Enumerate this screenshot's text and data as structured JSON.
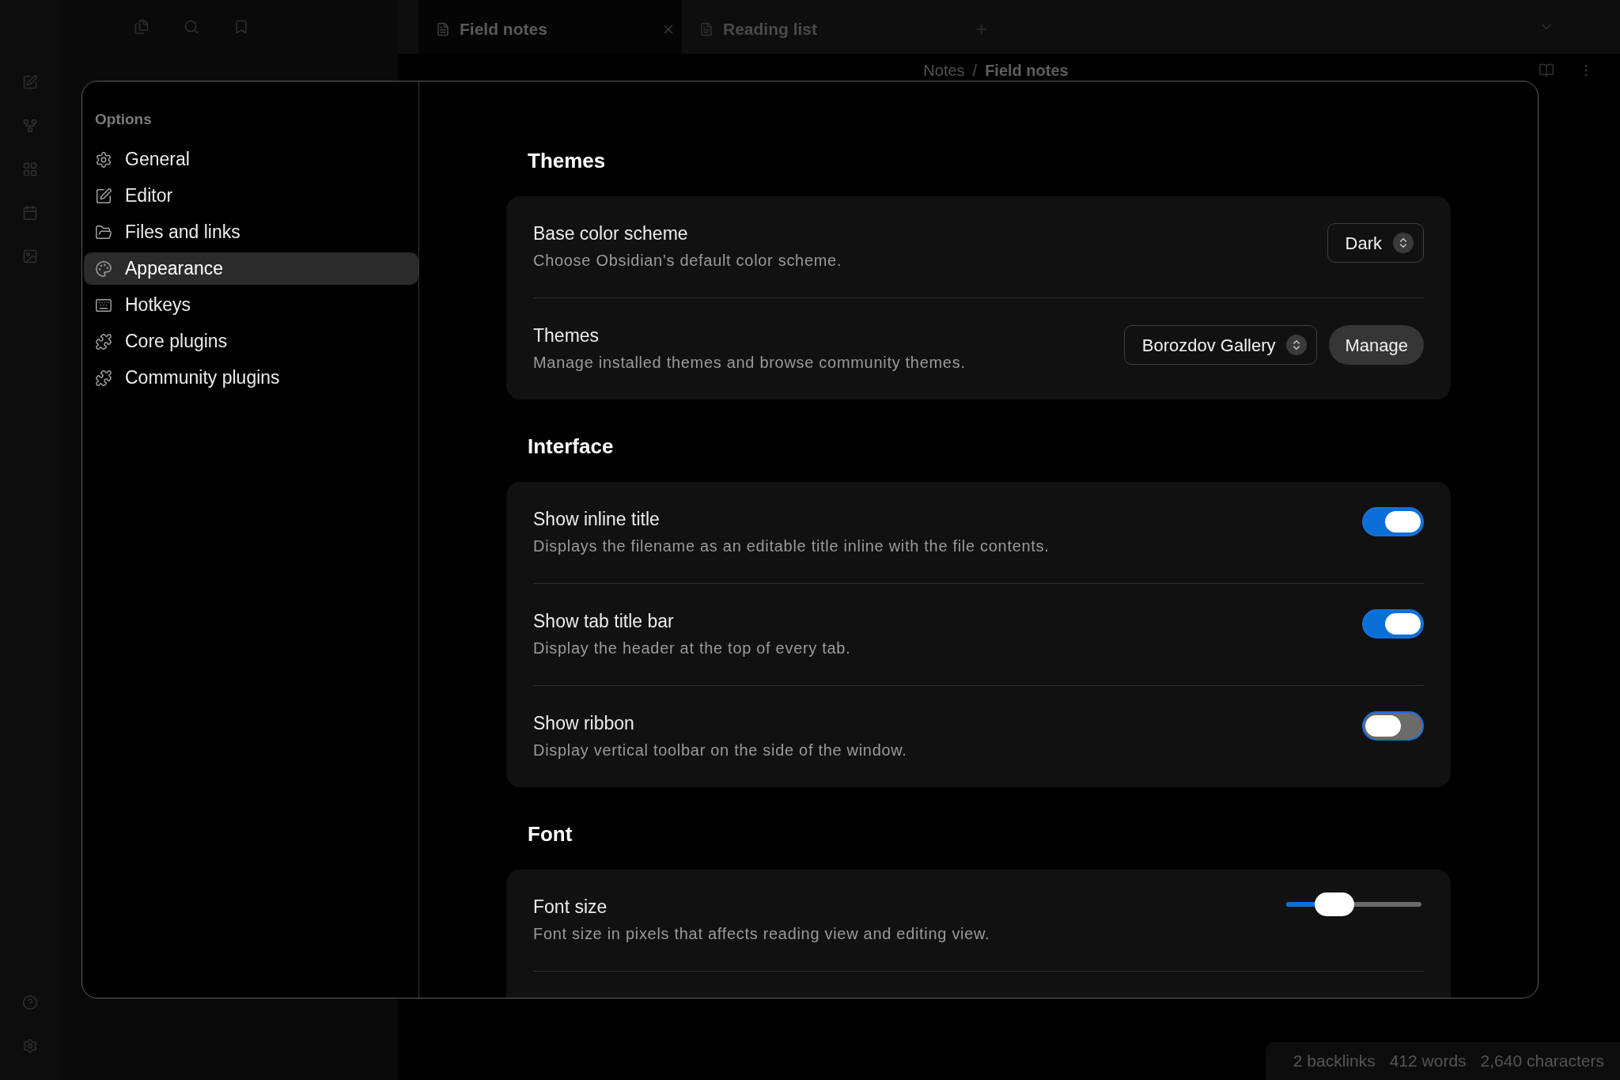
{
  "background": {
    "tabs": [
      {
        "title": "Field notes",
        "selected": true
      },
      {
        "title": "Reading list",
        "selected": false
      }
    ],
    "breadcrumb": {
      "items": [
        "Notes",
        "Field notes"
      ],
      "separator": "/"
    },
    "status_bar": [
      "2 backlinks",
      "412 words",
      "2,640 characters"
    ]
  },
  "settings": {
    "sidebar": {
      "heading": "Options",
      "items": [
        {
          "label": "General",
          "selected": false
        },
        {
          "label": "Editor",
          "selected": false
        },
        {
          "label": "Files and links",
          "selected": false
        },
        {
          "label": "Appearance",
          "selected": true
        },
        {
          "label": "Hotkeys",
          "selected": false
        },
        {
          "label": "Core plugins",
          "selected": false
        },
        {
          "label": "Community plugins",
          "selected": false
        }
      ]
    },
    "sections": [
      {
        "heading": "Themes",
        "settings": [
          {
            "kind": "dropdown",
            "name": "Base color scheme",
            "description": "Choose Obsidian's default color scheme.",
            "value": "Dark"
          },
          {
            "kind": "dropdown",
            "name": "Themes",
            "description": "Manage installed themes and browse community themes.",
            "value": "Borozdov Gallery",
            "button": "Manage"
          }
        ]
      },
      {
        "heading": "Interface",
        "settings": [
          {
            "kind": "toggle",
            "name": "Show inline title",
            "description": "Displays the filename as an editable title inline with the file contents.",
            "on": true
          },
          {
            "kind": "toggle",
            "name": "Show tab title bar",
            "description": "Display the header at the top of every tab.",
            "on": true
          },
          {
            "kind": "toggle",
            "name": "Show ribbon",
            "description": "Display vertical toolbar on the side of the window.",
            "on": false
          }
        ]
      },
      {
        "heading": "Font",
        "settings": [
          {
            "kind": "slider",
            "name": "Font size",
            "description": "Font size in pixels that affects reading view and editing view.",
            "level": 0.3
          }
        ]
      }
    ]
  }
}
